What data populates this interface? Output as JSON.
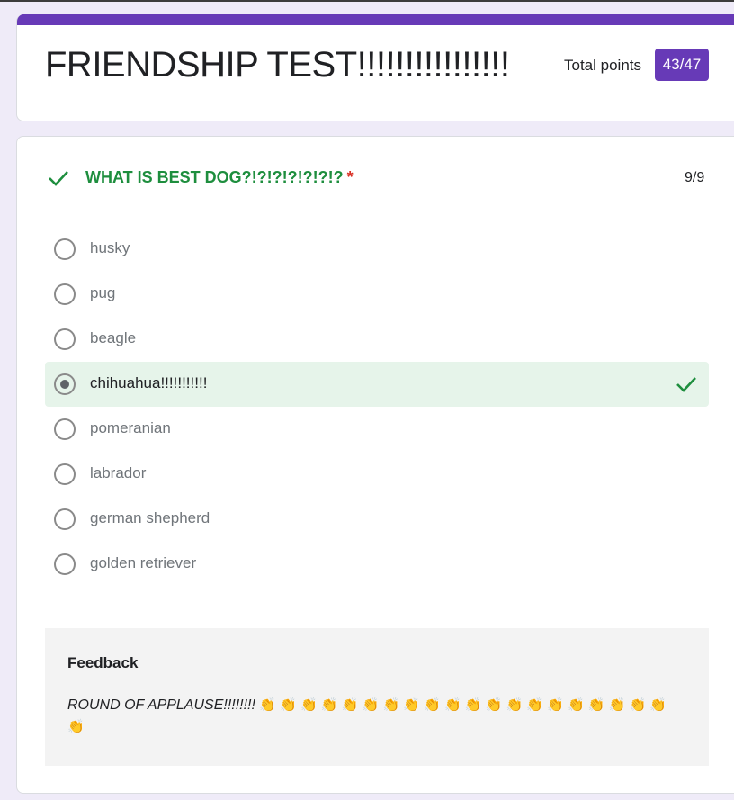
{
  "header": {
    "title": "FRIENDSHIP TEST!!!!!!!!!!!!!!!!",
    "points_label": "Total points",
    "points_value": "43/47",
    "accent": "#673ab7"
  },
  "question": {
    "title": "WHAT IS BEST DOG?!?!?!?!?!?!?",
    "required_mark": "*",
    "score": "9/9",
    "correct_icon": "check-icon",
    "options": [
      {
        "label": "husky",
        "selected": false
      },
      {
        "label": "pug",
        "selected": false
      },
      {
        "label": "beagle",
        "selected": false
      },
      {
        "label": "chihuahua!!!!!!!!!!!",
        "selected": true,
        "correct": true
      },
      {
        "label": "pomeranian",
        "selected": false
      },
      {
        "label": "labrador",
        "selected": false
      },
      {
        "label": "german shepherd",
        "selected": false
      },
      {
        "label": "golden retriever",
        "selected": false
      }
    ]
  },
  "feedback": {
    "heading": "Feedback",
    "text": "ROUND OF APPLAUSE!!!!!!!!",
    "claps": "👏 👏 👏 👏 👏 👏 👏 👏 👏 👏 👏 👏 👏 👏 👏 👏 👏 👏 👏 👏 👏"
  },
  "colors": {
    "correct_green": "#1e8e3e",
    "selected_bg": "#e6f4ea",
    "required_red": "#d93025"
  }
}
